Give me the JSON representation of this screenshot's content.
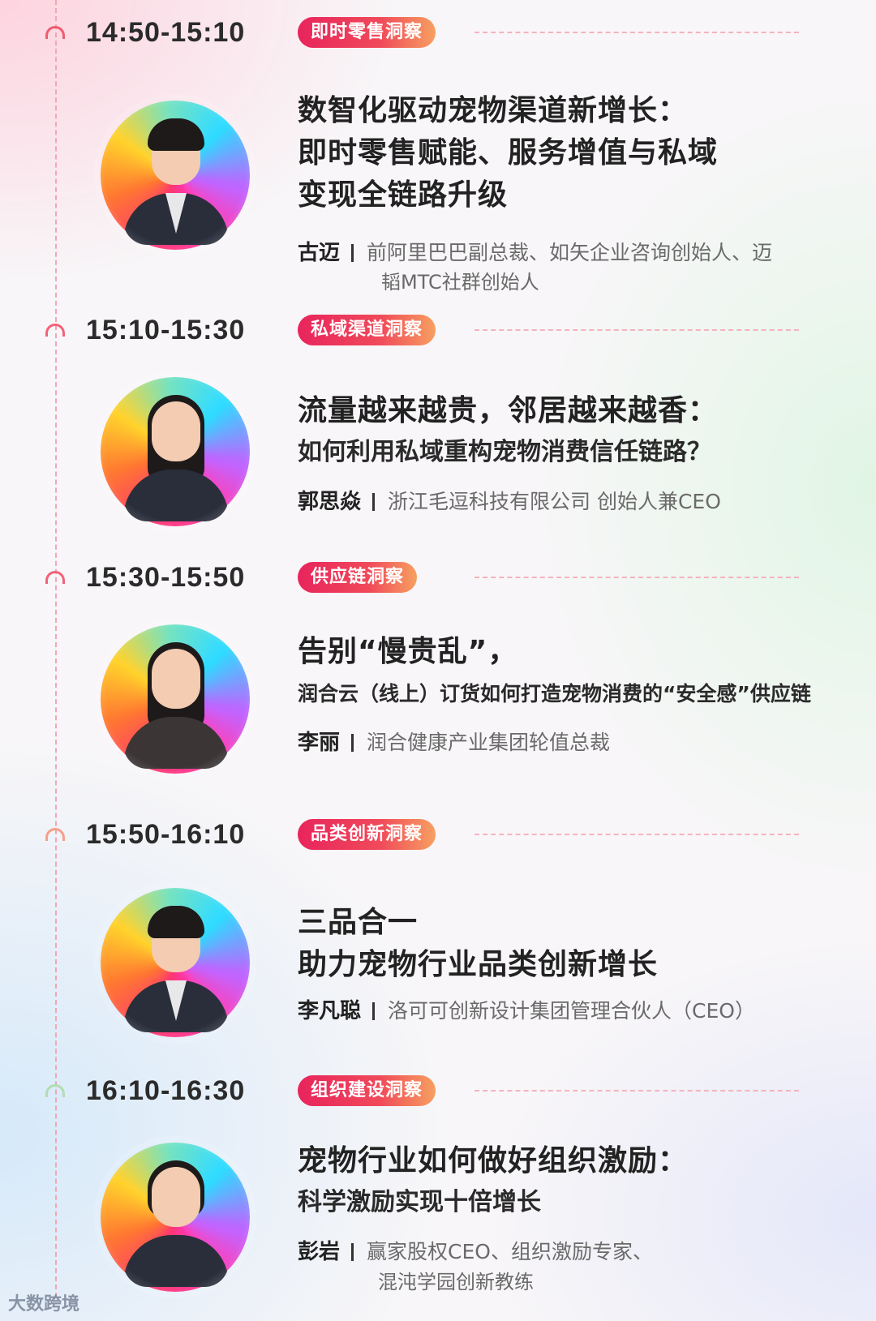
{
  "sessions": [
    {
      "time": "14:50-15:10",
      "tag": "即时零售洞察",
      "title_lines": [
        "数智化驱动宠物渠道新增长：",
        "即时零售赋能、服务增值与私域",
        "变现全链路升级"
      ],
      "speaker": "古迈",
      "role_lines": [
        "前阿里巴巴副总裁、如矢企业咨询创始人、迈",
        "韬MTC社群创始人"
      ],
      "colors": {
        "marker": "#f25a6e"
      }
    },
    {
      "time": "15:10-15:30",
      "tag": "私域渠道洞察",
      "title_lines": [
        "流量越来越贵，邻居越来越香："
      ],
      "subtitle_lines": [
        "如何利用私域重构宠物消费信任链路？"
      ],
      "speaker": "郭思焱",
      "role_lines": [
        "浙江毛逗科技有限公司 创始人兼CEO"
      ]
    },
    {
      "time": "15:30-15:50",
      "tag": "供应链洞察",
      "title_lines": [
        "告别“慢贵乱”，"
      ],
      "subtitle_lines": [
        "润合云（线上）订货如何打造宠物消费的“安全感”供应链"
      ],
      "speaker": "李丽",
      "role_lines": [
        "润合健康产业集团轮值总裁"
      ]
    },
    {
      "time": "15:50-16:10",
      "tag": "品类创新洞察",
      "title_lines": [
        "三品合一",
        "助力宠物行业品类创新增长"
      ],
      "speaker": "李凡聪",
      "role_lines": [
        "洛可可创新设计集团管理合伙人（CEO）"
      ]
    },
    {
      "time": "16:10-16:30",
      "tag": "组织建设洞察",
      "title_lines": [
        "宠物行业如何做好组织激励："
      ],
      "subtitle_lines": [
        "科学激励实现十倍增长"
      ],
      "speaker": "彭岩",
      "role_lines": [
        "赢家股权CEO、组织激励专家、",
        "混沌学园创新教练"
      ]
    }
  ],
  "watermark": "大数跨境",
  "colors": {
    "tag_gradient_start": "#e8245c",
    "tag_gradient_end": "#f7a060",
    "timeline": "#f2a6b4"
  }
}
